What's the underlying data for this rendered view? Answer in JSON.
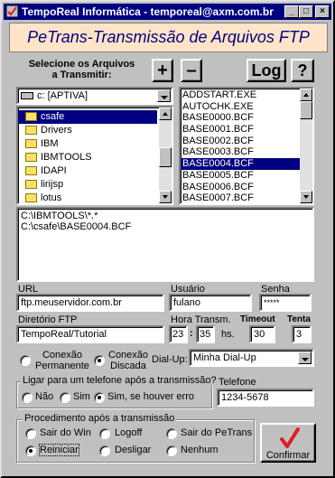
{
  "window": {
    "title": "TempoReal Informática - temporeal@axm.com.br",
    "min": "_",
    "max": "□",
    "close": "×"
  },
  "banner": "PeTrans-Transmissão de Arquivos FTP",
  "select_files_label_1": "Selecione os Arquivos",
  "select_files_label_2": "a Transmitir:",
  "buttons": {
    "add": "+",
    "remove": "–",
    "log": "Log",
    "help": "?",
    "confirm": "Confirmar"
  },
  "drive_value": "c: [APTIVA]",
  "folders": [
    "csafe",
    "Drivers",
    "IBM",
    "IBMTOOLS",
    "IDAPI",
    "lirijsp",
    "lotus"
  ],
  "selected_folder": "csafe",
  "files": [
    "ADDSTART.EXE",
    "AUTOCHK.EXE",
    "BASE0000.BCF",
    "BASE0001.BCF",
    "BASE0002.BCF",
    "BASE0003.BCF",
    "BASE0004.BCF",
    "BASE0005.BCF",
    "BASE0006.BCF",
    "BASE0007.BCF"
  ],
  "selected_file": "BASE0004.BCF",
  "selected_list": [
    "C:\\IBMTOOLS\\*.*",
    "C:\\csafe\\BASE0004.BCF"
  ],
  "url": {
    "label": "URL",
    "value": "ftp.meuservidor.com.br"
  },
  "usuario": {
    "label": "Usuário",
    "value": "fulano"
  },
  "senha": {
    "label": "Senha",
    "value": "*****"
  },
  "diretorio": {
    "label": "Diretório FTP",
    "value": "TempoReal/Tutorial"
  },
  "hora": {
    "label": "Hora Transm.",
    "hours": "23",
    "sep": ":",
    "minutes": "35",
    "unit": "hs."
  },
  "timeout": {
    "label": "Timeout",
    "value": "30"
  },
  "tentativas": {
    "label": "Tenta",
    "value": "3"
  },
  "conexao": {
    "permanente_1": "Conexão",
    "permanente_2": "Permanente",
    "discada_1": "Conexão",
    "discada_2": "Discada",
    "selected": "discada"
  },
  "dialup": {
    "label": "Dial-Up:",
    "value": "Minha Dial-Up"
  },
  "ligar": {
    "legend": "Ligar para um telefone após a transmissão?",
    "options": [
      "Não",
      "Sim",
      "Sim, se houver erro"
    ],
    "selected": 2
  },
  "telefone": {
    "label": "Telefone",
    "value": "1234-5678"
  },
  "procedimento": {
    "legend": "Procedimento após a transmissão",
    "options": [
      "Sair do Win",
      "Logoff",
      "Sair do PeTrans",
      "Reiniciar",
      "Desligar",
      "Nenhum"
    ],
    "selected": 3
  },
  "colors": {
    "title_bar": "#000080",
    "banner_bg": "#ffe4c8",
    "banner_text": "#000080",
    "window_bg": "#c0c0c0",
    "checkmark": "#e02020"
  }
}
